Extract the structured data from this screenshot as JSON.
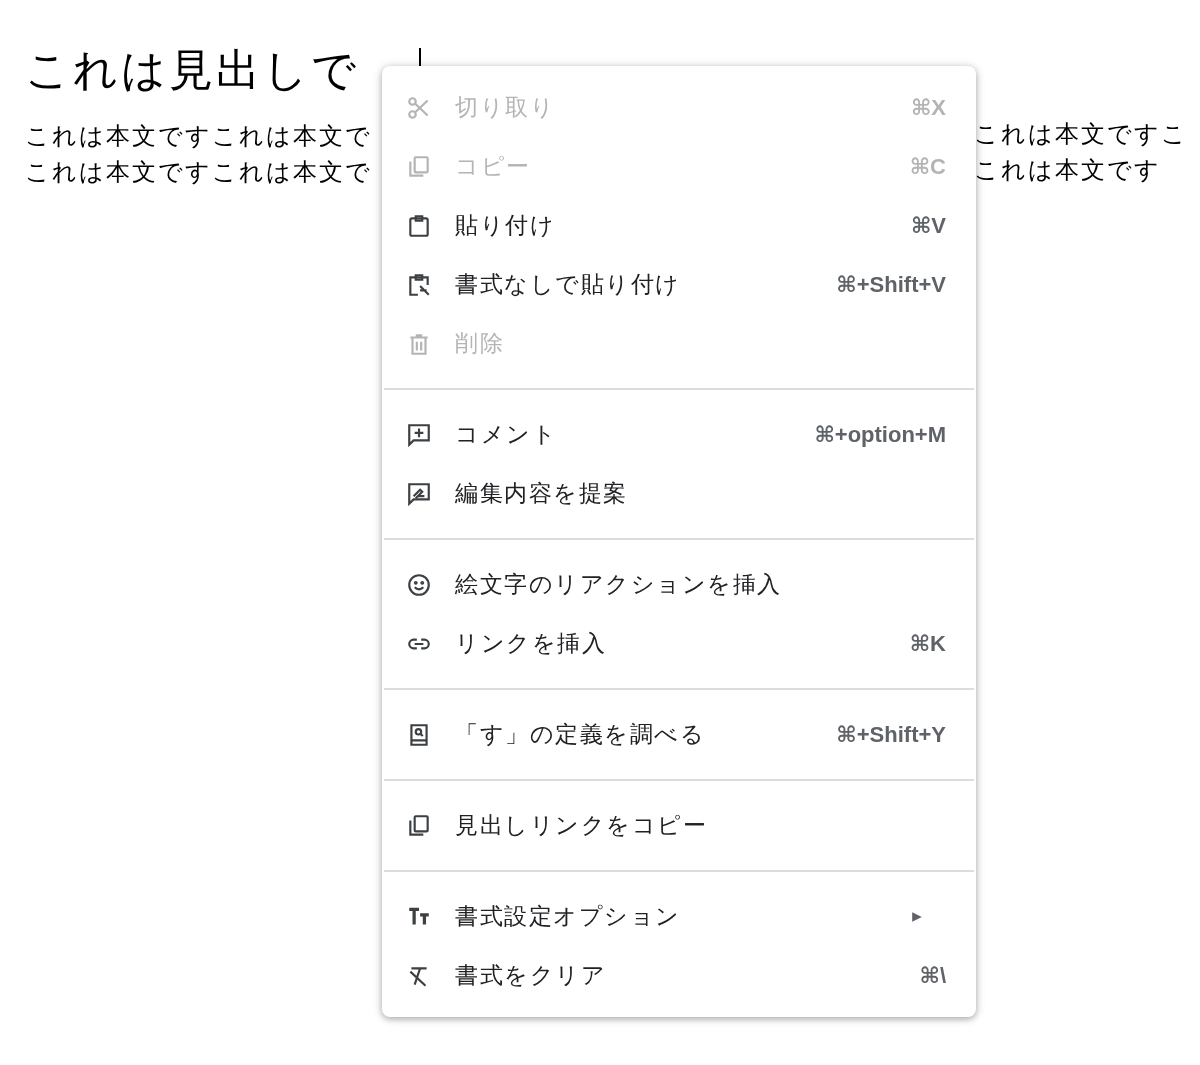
{
  "document": {
    "heading": "これは見出しで",
    "body_left": [
      "これは本文ですこれは本文で",
      "これは本文ですこれは本文で"
    ],
    "body_right": [
      "これは本文ですこ",
      "これは本文です"
    ]
  },
  "context_menu": {
    "groups": [
      {
        "items": [
          {
            "label": "切り取り",
            "shortcut": "⌘X",
            "disabled": true
          },
          {
            "label": "コピー",
            "shortcut": "⌘C",
            "disabled": true
          },
          {
            "label": "貼り付け",
            "shortcut": "⌘V",
            "disabled": false
          },
          {
            "label": "書式なしで貼り付け",
            "shortcut": "⌘+Shift+V",
            "disabled": false
          },
          {
            "label": "削除",
            "disabled": true
          }
        ]
      },
      {
        "items": [
          {
            "label": "コメント",
            "shortcut": "⌘+option+M",
            "disabled": false
          },
          {
            "label": "編集内容を提案",
            "disabled": false
          }
        ]
      },
      {
        "items": [
          {
            "label": "絵文字のリアクションを挿入",
            "disabled": false
          },
          {
            "label": "リンクを挿入",
            "shortcut": "⌘K",
            "disabled": false
          }
        ]
      },
      {
        "items": [
          {
            "label": "「す」の定義を調べる",
            "shortcut": "⌘+Shift+Y",
            "disabled": false
          }
        ]
      },
      {
        "items": [
          {
            "label": "見出しリンクをコピー",
            "disabled": false
          }
        ]
      },
      {
        "items": [
          {
            "label": "書式設定オプション",
            "submenu": true,
            "disabled": false
          },
          {
            "label": "書式をクリア",
            "shortcut": "⌘\\",
            "disabled": false
          }
        ]
      }
    ]
  }
}
